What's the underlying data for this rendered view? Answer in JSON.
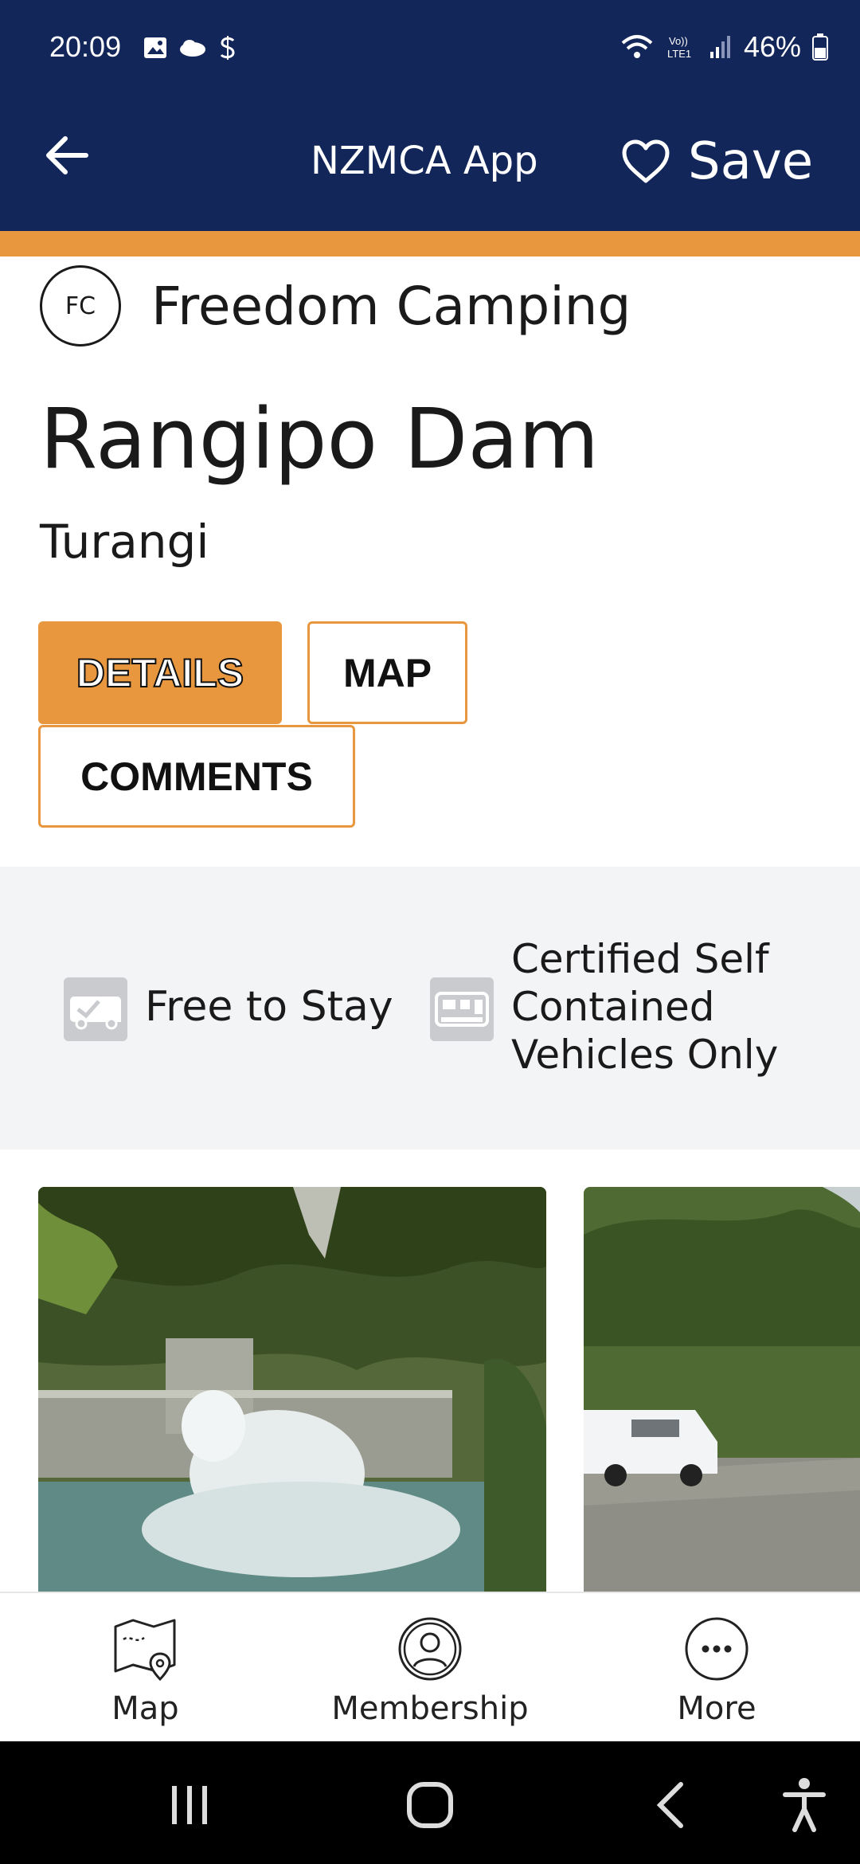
{
  "status_bar": {
    "time": "20:09",
    "left_icons": [
      "image-icon",
      "cloud-icon",
      "s-icon"
    ],
    "right_icons": [
      "wifi-icon",
      "volte-icon",
      "signal-icon"
    ],
    "battery": "46%"
  },
  "app_bar": {
    "title": "NZMCA App",
    "save_label": "Save",
    "back_icon": "back-arrow-icon",
    "save_icon": "heart-icon",
    "background": "#13265a",
    "accent": "#e8973e"
  },
  "place": {
    "category_badge": "FC",
    "category": "Freedom Camping",
    "title": "Rangipo Dam",
    "region": "Turangi"
  },
  "tabs": [
    {
      "label": "DETAILS",
      "active": true
    },
    {
      "label": "MAP",
      "active": false
    },
    {
      "label": "COMMENTS",
      "active": false
    }
  ],
  "features": [
    {
      "icon": "campervan-check-icon",
      "label": "Free to Stay"
    },
    {
      "icon": "self-contained-van-icon",
      "label": "Certified Self Contained Vehicles Only"
    }
  ],
  "photos": [
    {
      "subject": "dam-spillway-photo"
    },
    {
      "subject": "campervan-gravel-photo"
    }
  ],
  "bottom_nav": [
    {
      "icon": "map-pin-icon",
      "label": "Map"
    },
    {
      "icon": "person-circle-icon",
      "label": "Membership"
    },
    {
      "icon": "more-dots-icon",
      "label": "More"
    }
  ]
}
